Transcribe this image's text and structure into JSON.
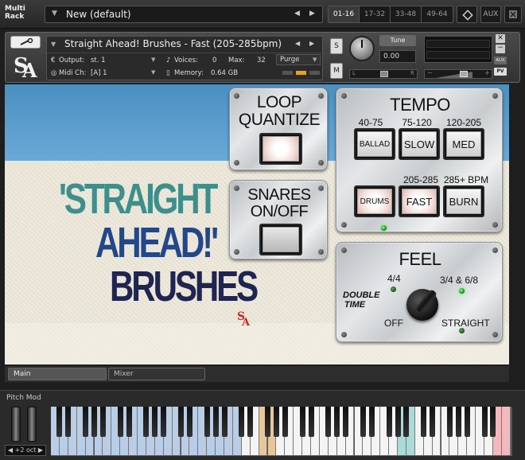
{
  "rack": {
    "title_line1": "Multi",
    "title_line2": "Rack",
    "preset_name": "New (default)",
    "pages": [
      "01-16",
      "17-32",
      "33-48",
      "49-64"
    ],
    "aux_label": "AUX"
  },
  "instrument": {
    "name": "Straight Ahead! Brushes - Fast (205-285bpm)",
    "output_label": "Output:",
    "output_value": "st. 1",
    "voices_label": "Voices:",
    "voices_value": "0",
    "max_label": "Max:",
    "max_value": "32",
    "purge_label": "Purge",
    "midi_label": "Midi Ch:",
    "midi_value": "[A] 1",
    "memory_label": "Memory:",
    "memory_value": "0.64 GB",
    "tune_label": "Tune",
    "tune_value": "0.00",
    "s_label": "S",
    "m_label": "M",
    "pan_l": "L",
    "pan_r": "R",
    "aux_small": "AUX",
    "pv_small": "PV"
  },
  "logo": {
    "line1": "'STRAIGHT",
    "line2": "AHEAD!'",
    "line3": "BRUSHES",
    "colors": {
      "teal": "#3e8f8c",
      "blue": "#22478a",
      "navy": "#1f2451",
      "red": "#d0281e"
    }
  },
  "loop_quantize": {
    "title_line1": "LOOP",
    "title_line2": "QUANTIZE"
  },
  "snares": {
    "title_line1": "SNARES",
    "title_line2": "ON/OFF"
  },
  "tempo": {
    "title": "TEMPO",
    "ranges_top": [
      "40-75",
      "75-120",
      "120-205"
    ],
    "buttons_top": [
      "BALLAD",
      "SLOW",
      "MED"
    ],
    "ranges_bottom": [
      "205-285",
      "285+ BPM"
    ],
    "buttons_bottom": [
      "DRUMS",
      "FAST",
      "BURN"
    ]
  },
  "feel": {
    "title": "FEEL",
    "double_time_line1": "DOUBLE",
    "double_time_line2": "TIME",
    "opt_44": "4/4",
    "opt_3468": "3/4 & 6/8",
    "opt_off": "OFF",
    "opt_straight": "STRAIGHT"
  },
  "tabs": {
    "main": "Main",
    "mixer": "Mixer"
  },
  "keyboard": {
    "pitch_mod_label": "Pitch Mod",
    "octave_label": "+2 oct",
    "colors": {
      "blue_zone": "#b9cde6",
      "orange_zone": "#e6c79a",
      "teal_zone": "#a9dcd8",
      "pink_zone": "#f2b9bd"
    }
  }
}
